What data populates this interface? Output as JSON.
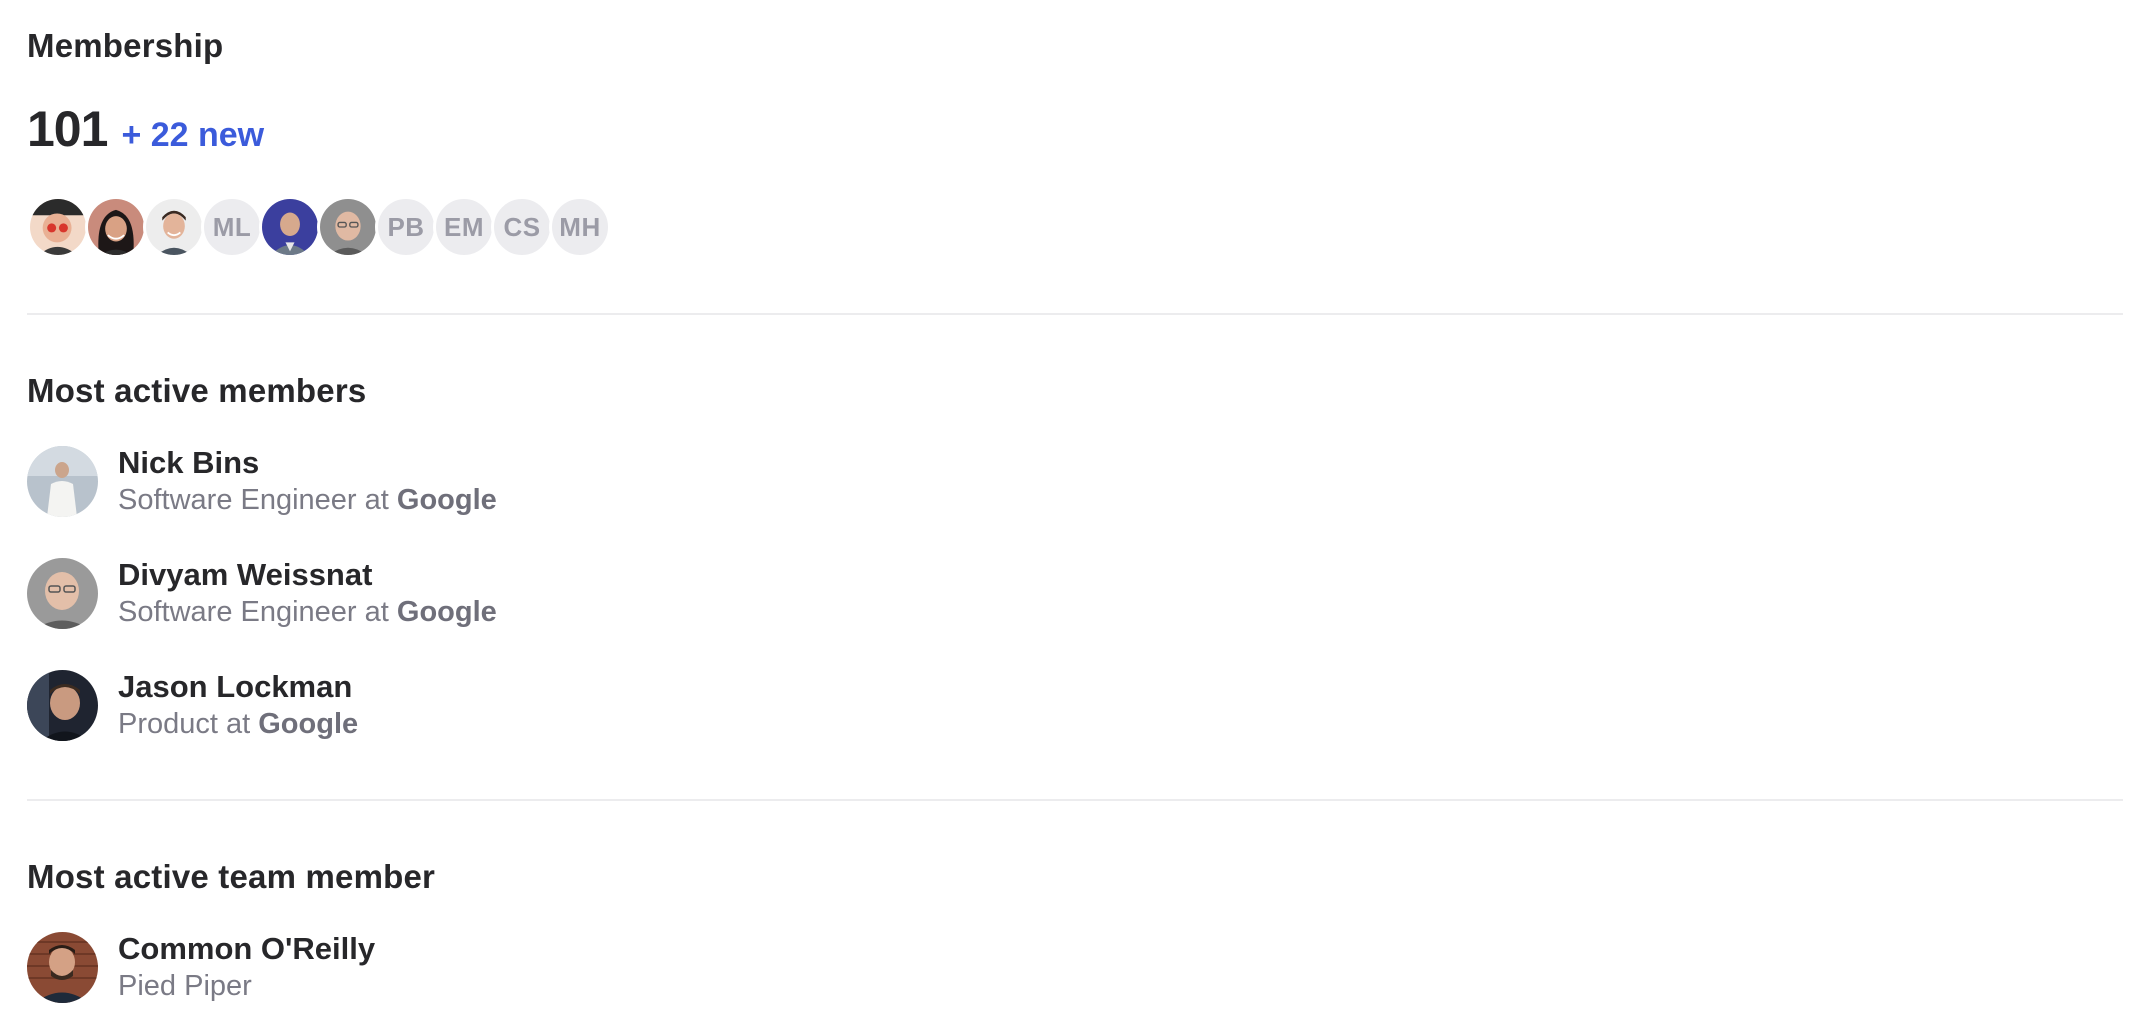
{
  "membership": {
    "title": "Membership",
    "count": "101",
    "new_label": "+ 22 new",
    "avatars": [
      {
        "type": "photo",
        "icon": "member-photo-1"
      },
      {
        "type": "photo",
        "icon": "member-photo-2"
      },
      {
        "type": "photo",
        "icon": "member-photo-3"
      },
      {
        "type": "initials",
        "text": "ML"
      },
      {
        "type": "photo",
        "icon": "member-photo-4"
      },
      {
        "type": "photo",
        "icon": "member-photo-5"
      },
      {
        "type": "initials",
        "text": "PB"
      },
      {
        "type": "initials",
        "text": "EM"
      },
      {
        "type": "initials",
        "text": "CS"
      },
      {
        "type": "initials",
        "text": "MH"
      }
    ]
  },
  "most_active": {
    "title": "Most active members",
    "members": [
      {
        "name": "Nick Bins",
        "role": "Software Engineer at",
        "company": "Google"
      },
      {
        "name": "Divyam Weissnat",
        "role": "Software Engineer at",
        "company": "Google"
      },
      {
        "name": "Jason Lockman",
        "role": "Product at",
        "company": "Google"
      }
    ]
  },
  "team": {
    "title": "Most active team member",
    "member": {
      "name": "Common O'Reilly",
      "org": "Pied Piper"
    }
  },
  "colors": {
    "accent": "#3b5bdb",
    "text": "#27272a",
    "muted": "#7a7a85",
    "divider": "#ececee",
    "initials_bg": "#ececef"
  }
}
